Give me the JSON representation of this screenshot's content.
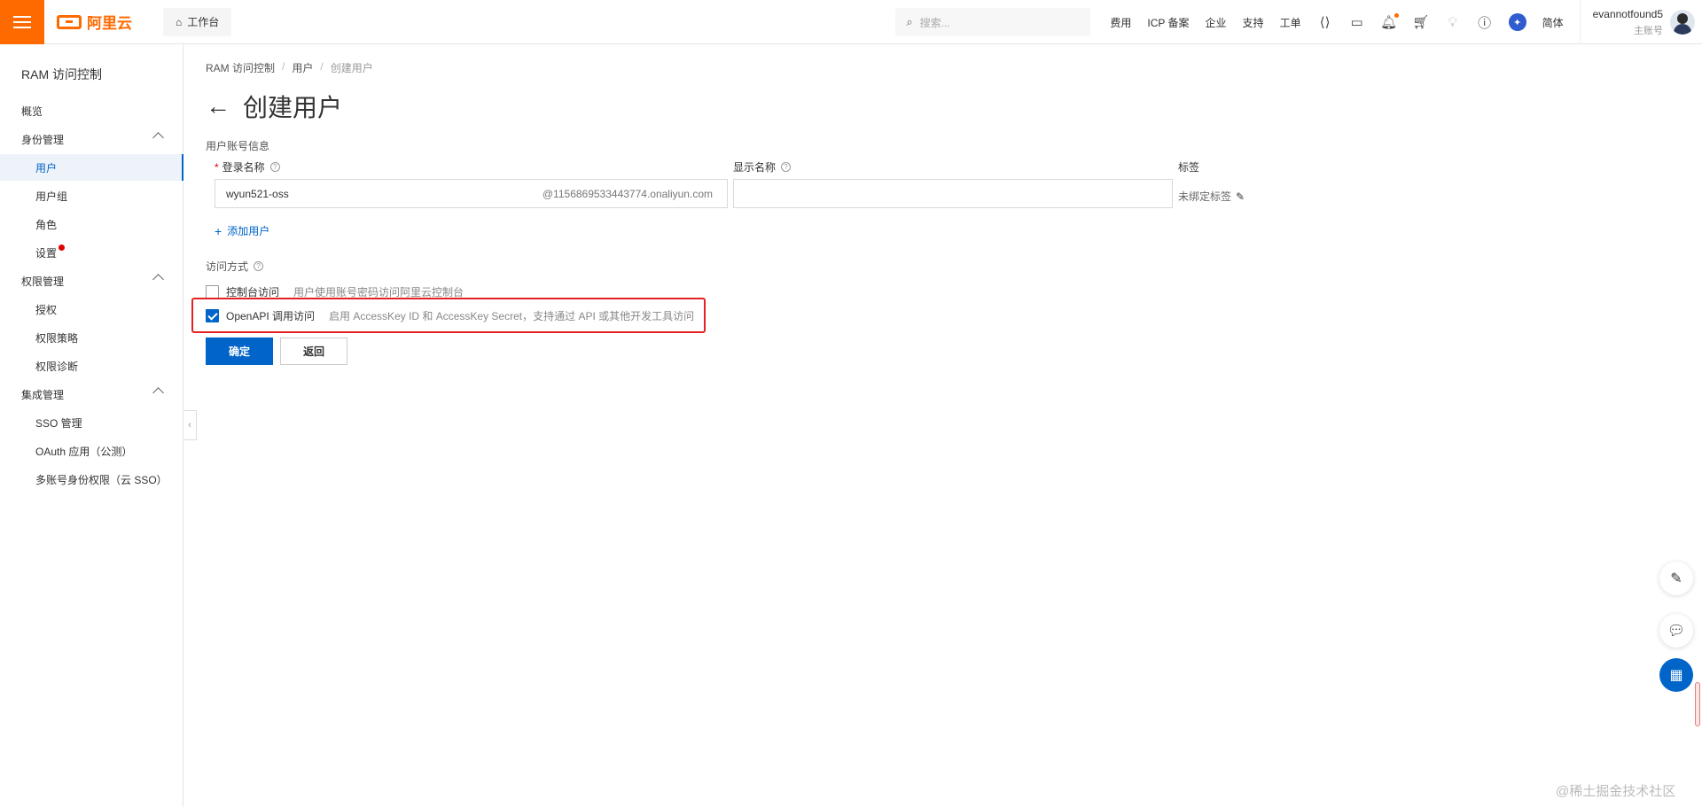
{
  "topbar": {
    "brand": "阿里云",
    "workbench": "工作台",
    "search_placeholder": "搜索...",
    "links": [
      "费用",
      "ICP 备案",
      "企业",
      "支持",
      "工单"
    ],
    "lang": "简体",
    "user_name": "evannotfound5",
    "user_role": "主账号",
    "accent_color": "#ff6a00"
  },
  "sidebar": {
    "title": "RAM 访问控制",
    "items": [
      {
        "label": "概览"
      },
      {
        "label": "身份管理"
      },
      {
        "label": "用户"
      },
      {
        "label": "用户组"
      },
      {
        "label": "角色"
      },
      {
        "label": "设置"
      },
      {
        "label": "权限管理"
      },
      {
        "label": "授权"
      },
      {
        "label": "权限策略"
      },
      {
        "label": "权限诊断"
      },
      {
        "label": "集成管理"
      },
      {
        "label": "SSO 管理"
      },
      {
        "label": "OAuth 应用（公测）"
      },
      {
        "label": "多账号身份权限（云 SSO）"
      }
    ]
  },
  "breadcrumb": [
    "RAM 访问控制",
    "用户",
    "创建用户"
  ],
  "page": {
    "title": "创建用户",
    "section_account": "用户账号信息",
    "login_name_label": "登录名称",
    "login_name_value": "wyun521-oss",
    "login_name_suffix": "@1156869533443774.onaliyun.com",
    "display_name_label": "显示名称",
    "display_name_value": "",
    "tag_label": "标签",
    "tag_value": "未绑定标签",
    "add_user": "添加用户",
    "access_label": "访问方式",
    "options": [
      {
        "name": "控制台访问",
        "desc": "用户使用账号密码访问阿里云控制台",
        "checked": false
      },
      {
        "name": "OpenAPI 调用访问",
        "desc": "启用 AccessKey ID 和 AccessKey Secret，支持通过 API 或其他开发工具访问",
        "checked": true
      }
    ],
    "confirm": "确定",
    "back": "返回",
    "primary_color": "#0064c8"
  },
  "watermark": "@稀土掘金技术社区"
}
